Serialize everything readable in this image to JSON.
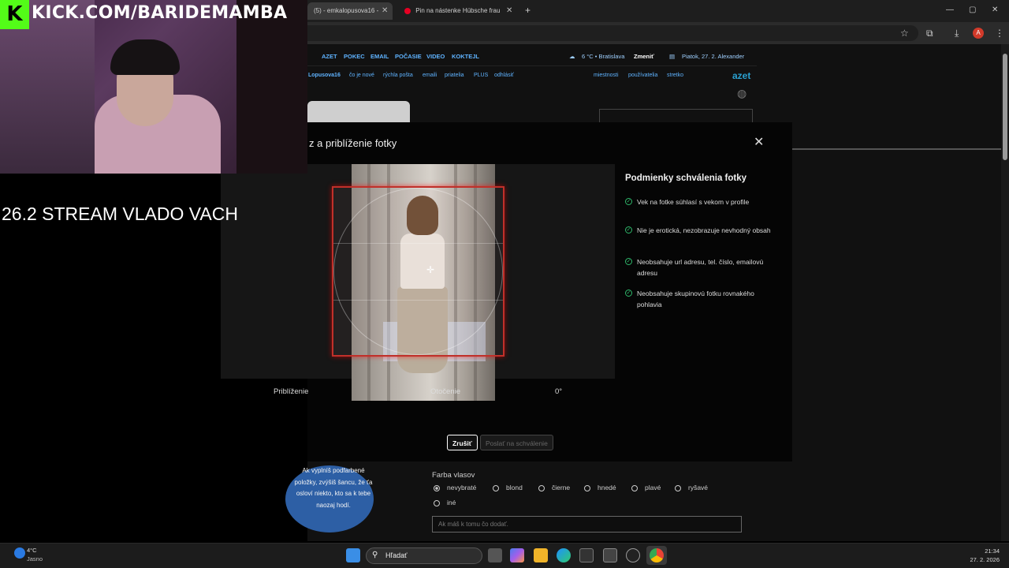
{
  "stream": {
    "kick_url": "KICK.COM/BARIDEMAMBA",
    "title": "26.2 STREAM VLADO VACH"
  },
  "browser": {
    "tabs": [
      {
        "label": "(5) - emkalopusova16 -",
        "active": true
      },
      {
        "label": "Pin na nástenke Hübsche frau",
        "active": false
      }
    ],
    "new_tab": "+",
    "close_glyph": "✕",
    "window_controls": [
      "—",
      "▢",
      "✕"
    ],
    "profile_initial": "A"
  },
  "site": {
    "nav": [
      "AZET",
      "POKEC",
      "EMAIL",
      "POČASIE",
      "VIDEO",
      "KOKTEJL"
    ],
    "weather": "6 °C • Bratislava",
    "weather_change": "Zmeniť",
    "date_line": "Piatok, 27. 2. Alexander",
    "subnav_left": [
      "Lopusova16",
      "čo je nové",
      "rýchla pošta",
      "emaili",
      "priatelia",
      "PLUS",
      "odhlásiť"
    ],
    "subnav_right": [
      "miestnosti",
      "používatelia",
      "stretko"
    ],
    "brand": "azet"
  },
  "modal": {
    "title": "z a priblíženie fotky",
    "zoom_label": "Priblíženie",
    "rotate_label": "Otočenie",
    "rotate_value": "0°",
    "conditions_title": "Podmienky schválenia fotky",
    "conditions": [
      "Vek na fotke súhlasí s vekom v profile",
      "Nie je erotická, nezobrazuje nevhodný obsah",
      "Neobsahuje url adresu, tel. číslo, emailovú adresu",
      "Neobsahuje skupinovú fotku rovnakého pohlavia"
    ],
    "cancel_button": "Zrušiť",
    "submit_button": "Poslať na schválenie"
  },
  "form": {
    "bubble_text": "Ak vyplníš podfarbené položky, zvýšiš šancu, že ťa osloví niekto, kto sa k tebe naozaj hodí.",
    "hair_label": "Farba vlasov",
    "hair_options": [
      "nevybraté",
      "blond",
      "čierne",
      "hnedé",
      "plavé",
      "ryšavé",
      "iné"
    ],
    "hair_selected": "nevybraté",
    "extra_placeholder": "Ak máš k tomu čo dodať."
  },
  "taskbar": {
    "temp": "4°C",
    "weather": "Jasno",
    "search_label": "Hľadať",
    "time": "21:34",
    "date": "27. 2. 2026"
  }
}
